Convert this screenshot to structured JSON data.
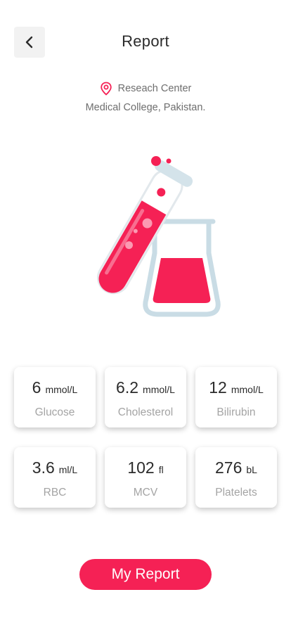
{
  "header": {
    "title": "Report"
  },
  "location": {
    "line1": "Reseach Center",
    "line2": "Medical College, Pakistan."
  },
  "metrics": [
    {
      "value": "6",
      "unit": "mmol/L",
      "label": "Glucose"
    },
    {
      "value": "6.2",
      "unit": "mmol/L",
      "label": "Cholesterol"
    },
    {
      "value": "12",
      "unit": "mmol/L",
      "label": "Bilirubin"
    },
    {
      "value": "3.6",
      "unit": "ml/L",
      "label": "RBC"
    },
    {
      "value": "102",
      "unit": "fl",
      "label": "MCV"
    },
    {
      "value": "276",
      "unit": "bL",
      "label": "Platelets"
    }
  ],
  "action": {
    "label": "My Report"
  },
  "colors": {
    "accent": "#f52155",
    "glass": "#c9dce5"
  }
}
